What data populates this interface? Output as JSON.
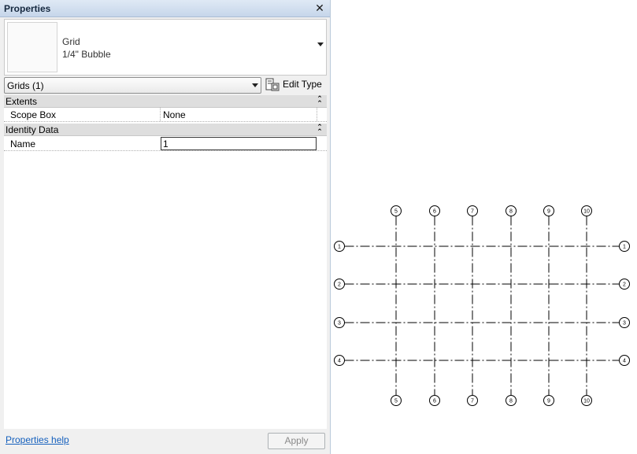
{
  "palette": {
    "title": "Properties",
    "close_glyph": "✕",
    "type_selector": {
      "family": "Grid",
      "type": "1/4\" Bubble"
    },
    "instance_filter": "Grids (1)",
    "edit_type_label": "Edit Type",
    "groups": [
      {
        "label": "Extents",
        "rows": [
          {
            "name": "Scope Box",
            "value": "None"
          }
        ]
      },
      {
        "label": "Identity Data",
        "rows": [
          {
            "name": "Name",
            "value": "1"
          }
        ]
      }
    ],
    "help_link": "Properties help",
    "apply_label": "Apply"
  },
  "grid": {
    "horizontal_labels": [
      "1",
      "2",
      "3",
      "4"
    ],
    "vertical_labels": [
      "5",
      "6",
      "7",
      "8",
      "9",
      "10"
    ]
  },
  "colors": {
    "titlebar": "#c6d6ea",
    "link": "#1560bd",
    "group_header": "#dedede"
  }
}
